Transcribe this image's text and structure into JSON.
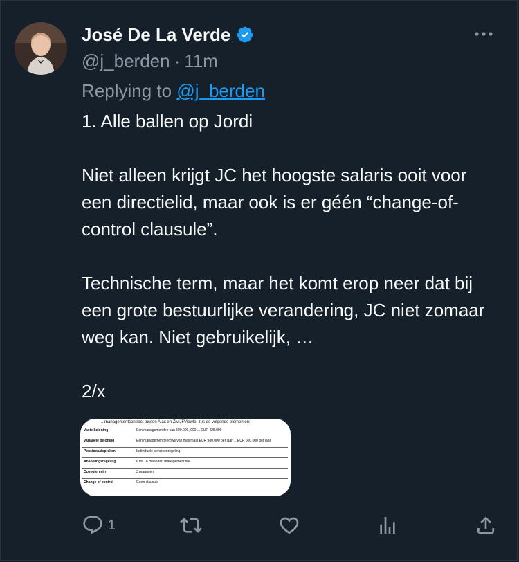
{
  "tweet": {
    "author_name": "José De La Verde",
    "handle": "@j_berden",
    "separator": "·",
    "time": "11m",
    "replying_prefix": "Replying to",
    "replying_to": "@j_berden",
    "paragraphs": [
      "1. Alle ballen op Jordi",
      "Niet alleen krijgt JC het hoogste salaris ooit voor een directielid, maar ook is er géén “change-of-control clausule”.",
      "Technische term, maar het komt erop neer dat bij een grote bestuurlijke verandering, JC niet zomaar weg kan. Niet gebruikelijk, …",
      "2/x"
    ],
    "attachment": {
      "title": "...managementcontract tussen Ajax en Ziv/JFViewlel zus de volgende elementen:",
      "rows": [
        {
          "k": "Vaste beloning",
          "v": "Een managementfee van 500.000, 000 ... EUR 425.000"
        },
        {
          "k": "Variabele beloning",
          "v": "Een managementfeerows van maximaal EUR 980.000 per jaar ... EUR 600.000 per jaar"
        },
        {
          "k": "Pensioenafspraken",
          "v": "Individuele pensioenregeling"
        },
        {
          "k": "Afvloeiingsregeling",
          "v": "6 tot 18 maanden management fee"
        },
        {
          "k": "Opzegtermijn",
          "v": "3 maanden"
        },
        {
          "k": "Change of control",
          "v": "Geen clausule"
        }
      ]
    },
    "actions": {
      "reply_count": "1"
    }
  },
  "colors": {
    "background": "#15202b",
    "text": "#f7f9f9",
    "secondary": "#8b98a5",
    "accent": "#1d9bf0"
  },
  "icons": [
    "verified-badge-icon",
    "more-icon",
    "reply-icon",
    "retweet-icon",
    "like-icon",
    "views-icon",
    "share-icon"
  ]
}
